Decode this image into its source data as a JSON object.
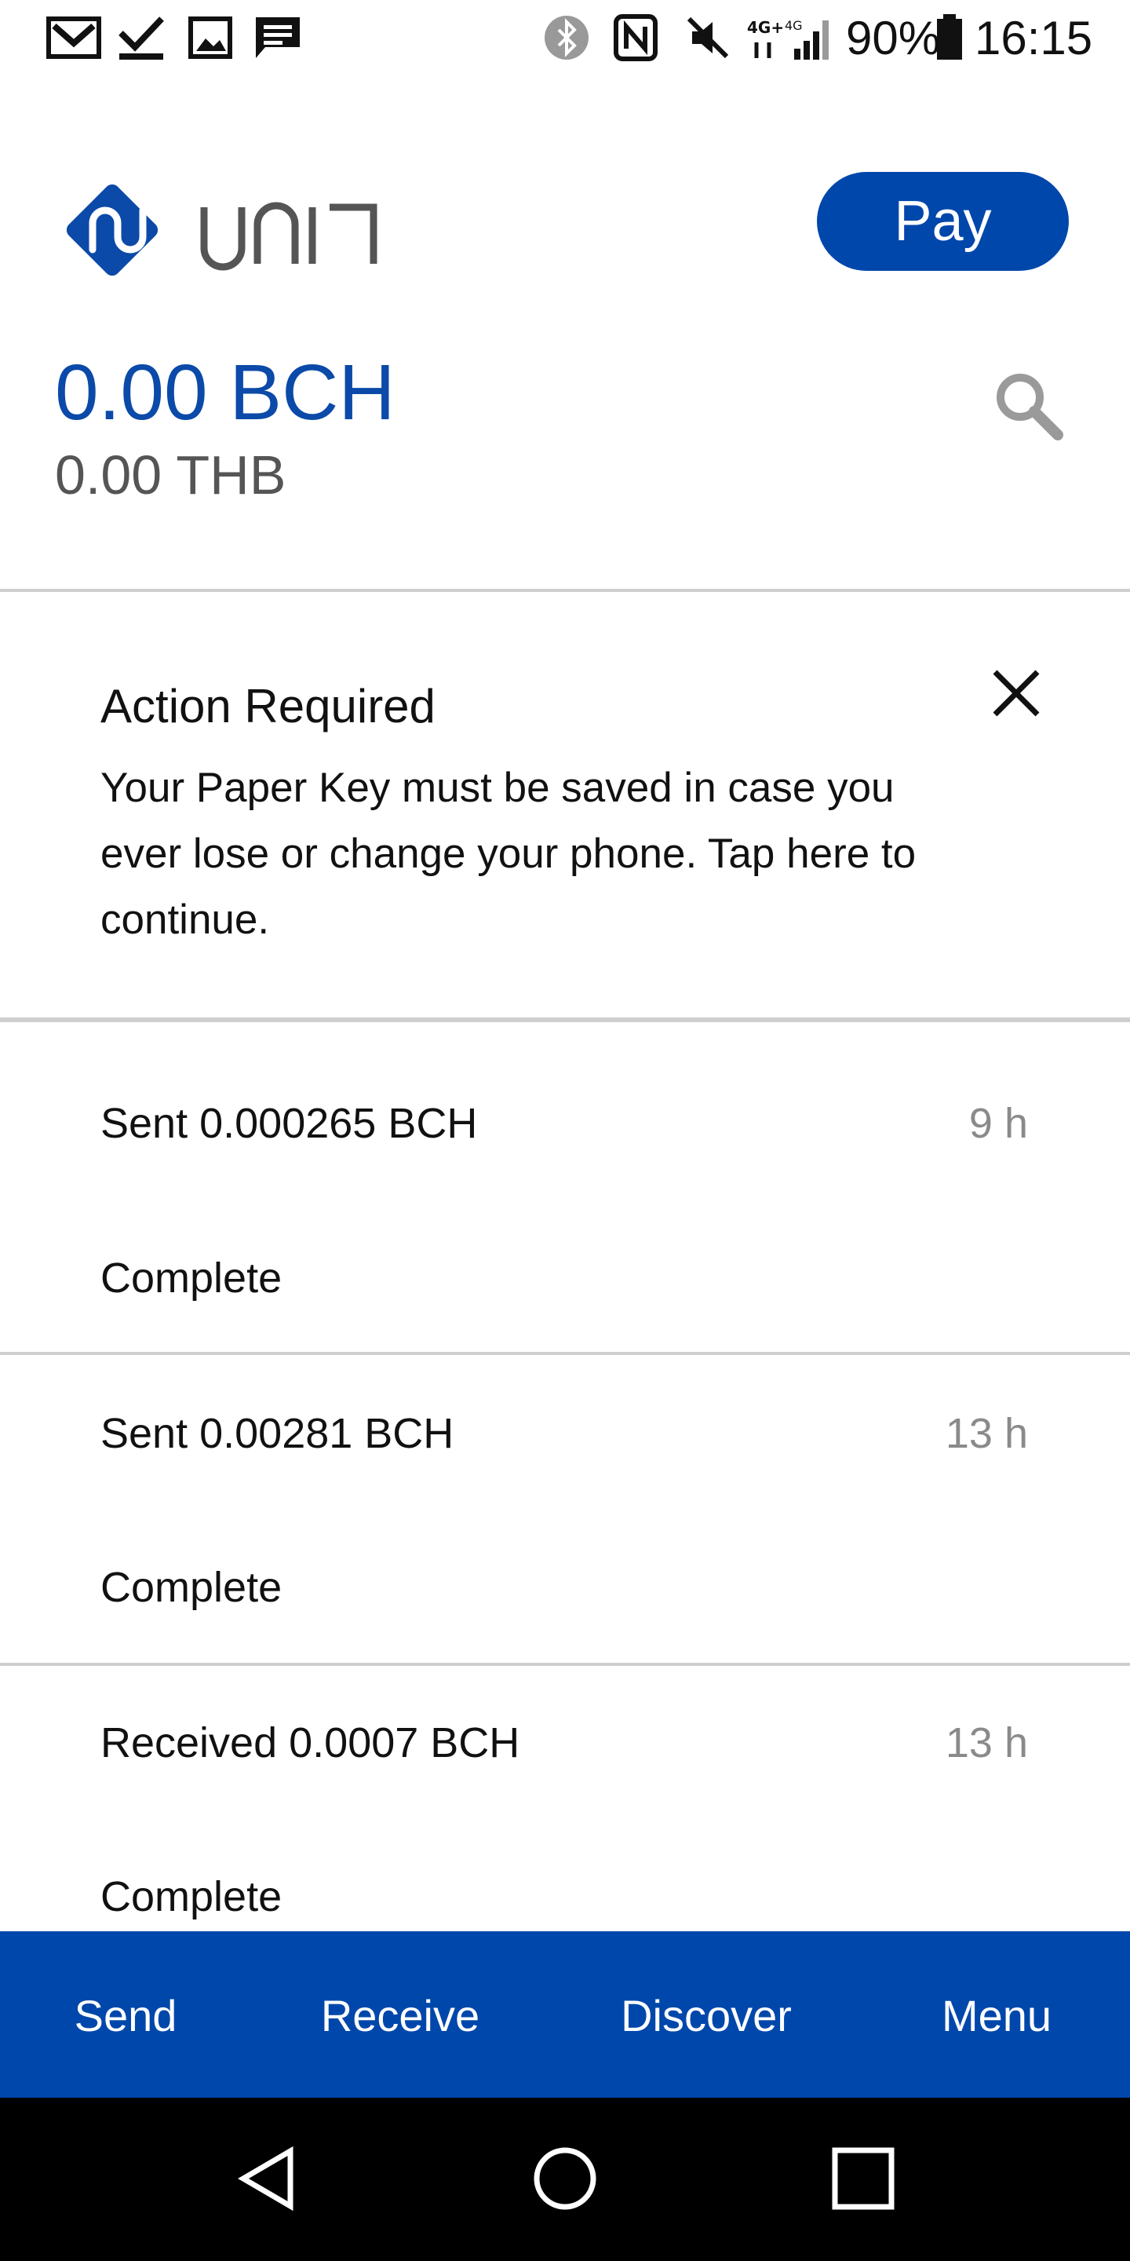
{
  "status_bar": {
    "battery_percent": "90%",
    "time": "16:15",
    "network": "4G",
    "icons": [
      "gmail-icon",
      "check-icon",
      "image-icon",
      "message-icon",
      "bluetooth-icon",
      "nfc-icon",
      "mute-icon",
      "signal-icon",
      "battery-icon"
    ]
  },
  "header": {
    "pay_label": "Pay",
    "balance_crypto": "0.00 BCH",
    "balance_fiat": "0.00 THB"
  },
  "notice": {
    "title": "Action Required",
    "body_line1": "Your Paper Key must be saved in case you",
    "body_line2": "ever lose or change your phone. Tap here to",
    "body_line3": "continue."
  },
  "transactions": [
    {
      "title": "Sent 0.000265 BCH",
      "time": "9 h",
      "status": "Complete"
    },
    {
      "title": "Sent 0.00281 BCH",
      "time": "13 h",
      "status": "Complete"
    },
    {
      "title": "Received 0.0007 BCH",
      "time": "13 h",
      "status": "Complete"
    }
  ],
  "tabs": {
    "send": "Send",
    "receive": "Receive",
    "discover": "Discover",
    "menu": "Menu"
  },
  "colors": {
    "accent": "#0047ab",
    "balance_text": "#0b4aa8",
    "muted_text": "#8a8a8a"
  }
}
